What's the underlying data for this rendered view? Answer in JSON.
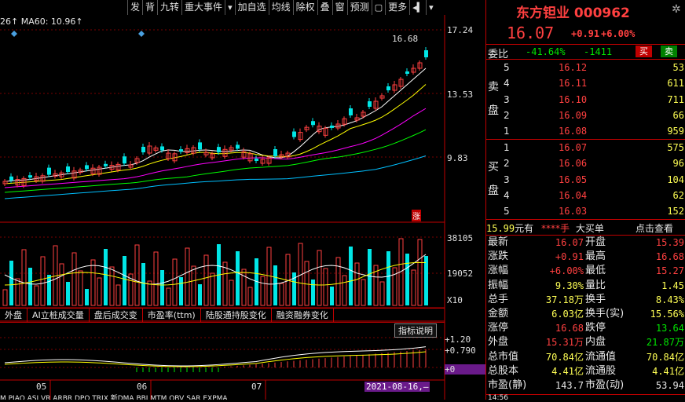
{
  "toolbar": {
    "items": [
      "发",
      "背",
      "九转",
      "重大事件",
      "▾",
      "加自选",
      "均线",
      "除权",
      "叠",
      "窗",
      "预测",
      "▢",
      "更多",
      "◂▍",
      "▾"
    ]
  },
  "chart": {
    "ma_legend": "26↑  MA60: 10.96↑",
    "price_axis": [
      "17.24",
      "13.53",
      "9.83"
    ],
    "peak_label": "16.68",
    "zhang_badge": "涨",
    "volume_axis": [
      "38105",
      "19052"
    ],
    "volume_unit": "X10",
    "indicator_help": "指标说明",
    "indicator_axis": [
      "+1.20",
      "+0.790",
      "+0"
    ],
    "months": [
      "05",
      "06",
      "07"
    ],
    "date_badge": "2021-08-16,—"
  },
  "tabs": [
    "外盘",
    "AI立桩成交量",
    "盘后成交变",
    "市盈率(ttm)",
    "陆股通持股变化",
    "融资融券变化"
  ],
  "bottom_tabs": "M  PIAO   ASI   VR   ARBR   DPO   TRIX   新DMA   BBI   MTM   OBV   SAR   EXPMA",
  "quote": {
    "name": "东方钽业 000962",
    "price": "16.07",
    "change": "+0.91",
    "change_pct": "+6.00%",
    "weibi_label": "委比",
    "weibi_pct": "-41.64%",
    "weibi_diff": "-1411",
    "buy_btn": "买",
    "sell_btn": "卖",
    "sell_label": "卖盘",
    "buy_label": "买盘",
    "asks": [
      {
        "lvl": "5",
        "price": "16.12",
        "vol": "53"
      },
      {
        "lvl": "4",
        "price": "16.11",
        "vol": "611"
      },
      {
        "lvl": "3",
        "price": "16.10",
        "vol": "711"
      },
      {
        "lvl": "2",
        "price": "16.09",
        "vol": "66"
      },
      {
        "lvl": "1",
        "price": "16.08",
        "vol": "959"
      }
    ],
    "bids": [
      {
        "lvl": "1",
        "price": "16.07",
        "vol": "575"
      },
      {
        "lvl": "2",
        "price": "16.06",
        "vol": "96"
      },
      {
        "lvl": "3",
        "price": "16.05",
        "vol": "104"
      },
      {
        "lvl": "4",
        "price": "16.04",
        "vol": "62"
      },
      {
        "lvl": "5",
        "price": "16.03",
        "vol": "152"
      }
    ],
    "big_order": {
      "price": "15.99",
      "unit": "元有",
      "hands": "****手",
      "label": "大买单",
      "link": "点击查看"
    },
    "stats": [
      {
        "l1": "最新",
        "v1": "16.07",
        "c1": "red",
        "l2": "开盘",
        "v2": "15.39",
        "c2": "red"
      },
      {
        "l1": "涨跌",
        "v1": "+0.91",
        "c1": "red",
        "l2": "最高",
        "v2": "16.68",
        "c2": "red"
      },
      {
        "l1": "涨幅",
        "v1": "+6.00%",
        "c1": "red",
        "l2": "最低",
        "v2": "15.27",
        "c2": "red"
      },
      {
        "l1": "振幅",
        "v1": "9.30%",
        "c1": "yellow",
        "l2": "量比",
        "v2": "1.45",
        "c2": "yellow"
      },
      {
        "l1": "总手",
        "v1": "37.18万",
        "c1": "yellow",
        "l2": "换手",
        "v2": "8.43%",
        "c2": "yellow"
      },
      {
        "l1": "金额",
        "v1": "6.03亿",
        "c1": "yellow",
        "l2": "换手(实)",
        "v2": "15.56%",
        "c2": "yellow"
      },
      {
        "l1": "涨停",
        "v1": "16.68",
        "c1": "red",
        "l2": "跌停",
        "v2": "13.64",
        "c2": "green"
      },
      {
        "l1": "外盘",
        "v1": "15.31万",
        "c1": "red",
        "l2": "内盘",
        "v2": "21.87万",
        "c2": "green"
      },
      {
        "l1": "总市值",
        "v1": "70.84亿",
        "c1": "yellow",
        "l2": "流通值",
        "v2": "70.84亿",
        "c2": "yellow"
      },
      {
        "l1": "总股本",
        "v1": "4.41亿",
        "c1": "yellow",
        "l2": "流通股",
        "v2": "4.41亿",
        "c2": "yellow"
      },
      {
        "l1": "市盈(静)",
        "v1": "143.7",
        "c1": "white",
        "l2": "市盈(动)",
        "v2": "53.94",
        "c2": "white"
      }
    ],
    "bottom_time": "14:56"
  },
  "colors": {
    "up": "#ff4040",
    "down": "#00e6e6",
    "grid": "#7a0000",
    "ma5": "#ffffff",
    "ma10": "#ffff00",
    "ma20": "#ff00ff",
    "ma30": "#00ff00",
    "ma60": "#00c0ff"
  }
}
